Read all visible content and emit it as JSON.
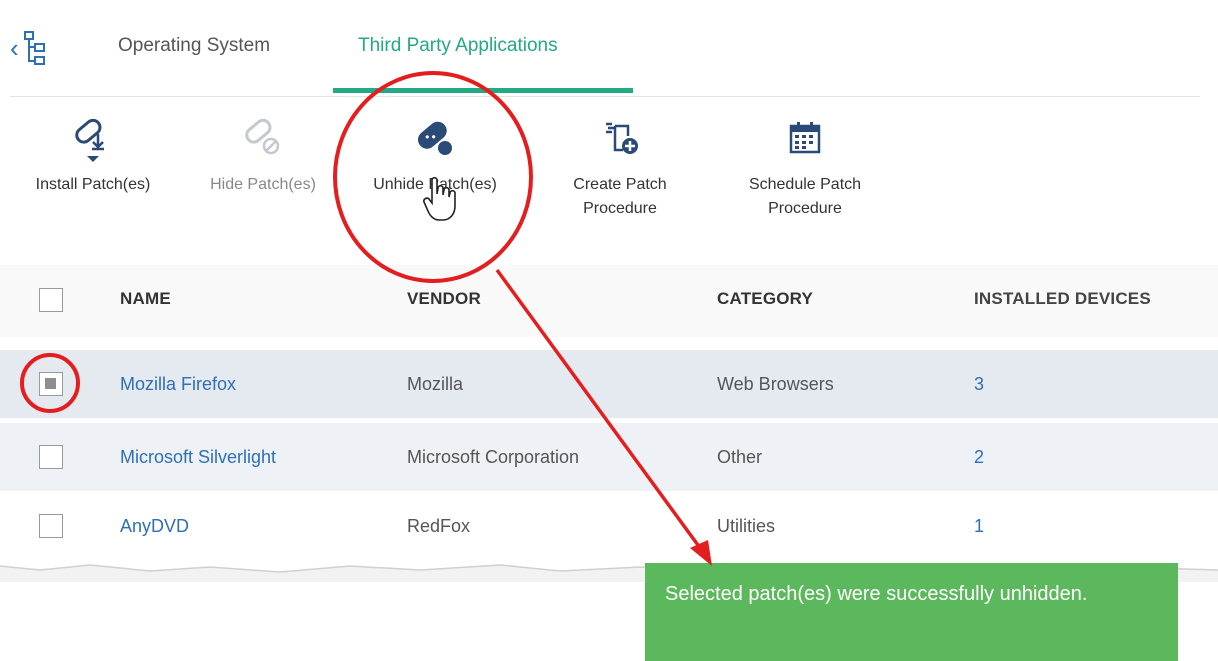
{
  "tabs": [
    {
      "label": "Operating System",
      "active": false
    },
    {
      "label": "Third Party Applications",
      "active": true
    }
  ],
  "toolbar": {
    "install": "Install Patch(es)",
    "hide": "Hide Patch(es)",
    "unhide": "Unhide Patch(es)",
    "create_line1": "Create Patch",
    "create_line2": "Procedure",
    "schedule_line1": "Schedule Patch",
    "schedule_line2": "Procedure"
  },
  "table": {
    "headers": {
      "name": "NAME",
      "vendor": "VENDOR",
      "category": "CATEGORY",
      "devices": "INSTALLED DEVICES"
    },
    "rows": [
      {
        "name": "Mozilla Firefox",
        "vendor": "Mozilla",
        "category": "Web Browsers",
        "devices": "3",
        "checked": true
      },
      {
        "name": "Microsoft Silverlight",
        "vendor": "Microsoft Corporation",
        "category": "Other",
        "devices": "2",
        "checked": false
      },
      {
        "name": "AnyDVD",
        "vendor": "RedFox",
        "category": "Utilities",
        "devices": "1",
        "checked": false
      }
    ]
  },
  "toast": {
    "message": "Selected patch(es) were successfully unhidden."
  },
  "icons": {
    "back": "chevron-left-icon",
    "tree": "tree-icon",
    "install": "install-patch-icon",
    "hide": "hide-patch-icon",
    "unhide": "unhide-patch-icon",
    "create": "create-procedure-icon",
    "schedule": "calendar-icon"
  },
  "colors": {
    "accent": "#23a984",
    "link": "#2e6fb6",
    "toast": "#5cb85c",
    "annotation": "#e41e1e",
    "selected_row": "#e5eaf1"
  }
}
